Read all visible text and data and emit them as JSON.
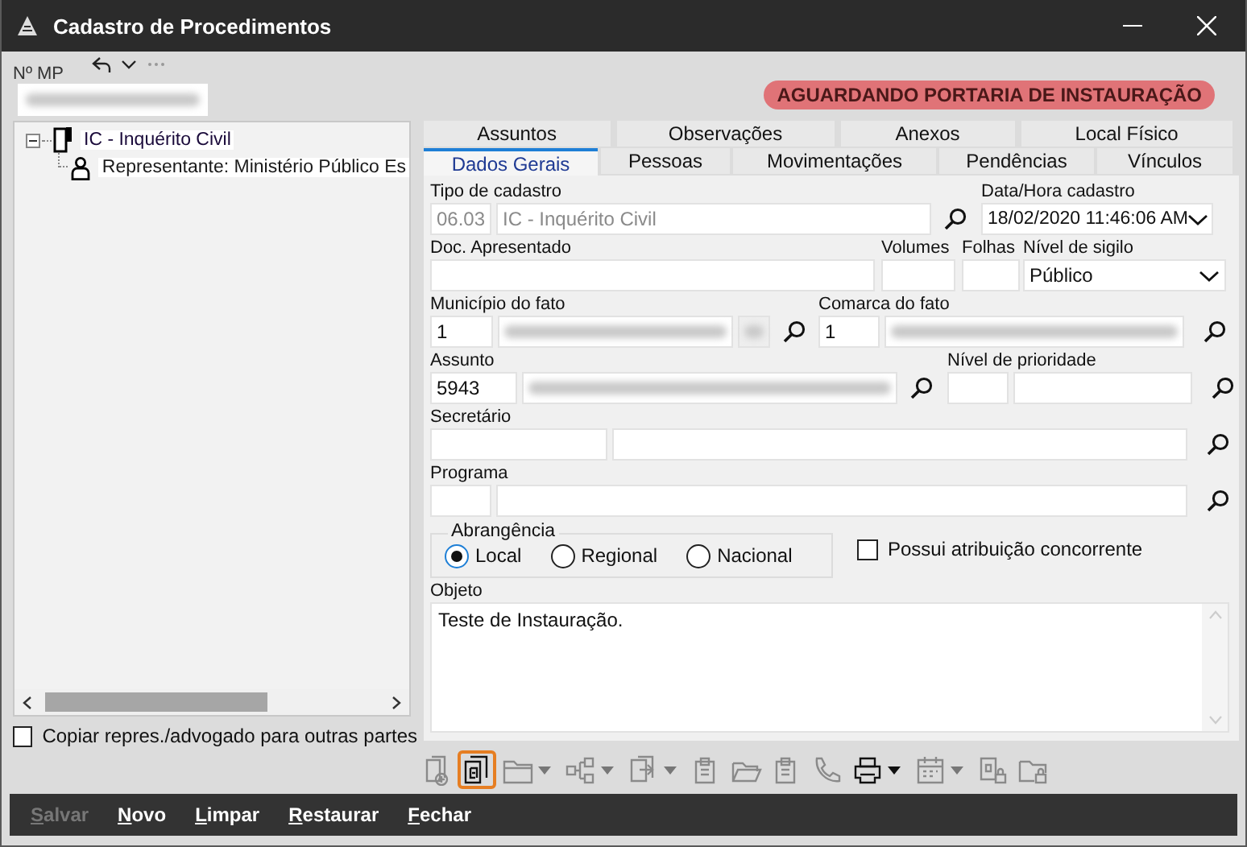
{
  "window": {
    "title": "Cadastro de Procedimentos"
  },
  "mp": {
    "label": "Nº MP",
    "redacted": true
  },
  "status_badge": "AGUARDANDO PORTARIA DE INSTAURAÇÃO",
  "tree": [
    {
      "label": "IC - Inquérito Civil",
      "expanded": true,
      "children": [
        {
          "label": "Representante: Ministério Público Es"
        }
      ]
    }
  ],
  "copy_checkbox": {
    "label": "Copiar repres./advogado para outras partes",
    "checked": false
  },
  "tab_rows": [
    {
      "tabs": [
        {
          "label": "Assuntos",
          "selected": false
        },
        {
          "label": "Observações",
          "selected": false
        },
        {
          "label": "Anexos",
          "selected": false
        },
        {
          "label": "Local Físico",
          "selected": false
        }
      ]
    },
    {
      "tabs": [
        {
          "label": "Dados Gerais",
          "selected": true
        },
        {
          "label": "Pessoas",
          "selected": false
        },
        {
          "label": "Movimentações",
          "selected": false
        },
        {
          "label": "Pendências",
          "selected": false
        },
        {
          "label": "Vínculos",
          "selected": false
        }
      ]
    }
  ],
  "form": {
    "tipo": {
      "label": "Tipo de cadastro",
      "code": "06.03",
      "value": "IC - Inquérito Civil",
      "disabled": true
    },
    "data_hora": {
      "label": "Data/Hora cadastro",
      "value": "18/02/2020 11:46:06 AM"
    },
    "doc": {
      "label": "Doc. Apresentado"
    },
    "volumes": {
      "label": "Volumes"
    },
    "folhas": {
      "label": "Folhas"
    },
    "sigilo": {
      "label": "Nível de sigilo",
      "value": "Público"
    },
    "municipio": {
      "label": "Município do fato",
      "code": "1",
      "redacted": true
    },
    "comarca": {
      "label": "Comarca do fato",
      "code": "1",
      "redacted": true
    },
    "assunto": {
      "label": "Assunto",
      "code": "5943",
      "redacted": true
    },
    "prioridade": {
      "label": "Nível de prioridade"
    },
    "secretario": {
      "label": "Secretário"
    },
    "programa": {
      "label": "Programa"
    },
    "abrangencia": {
      "label": "Abrangência",
      "options": [
        {
          "label": "Local",
          "selected": true
        },
        {
          "label": "Regional",
          "selected": false
        },
        {
          "label": "Nacional",
          "selected": false
        }
      ]
    },
    "concorrente": {
      "label": "Possui atribuição concorrente",
      "checked": false
    },
    "objeto": {
      "label": "Objeto",
      "value": "Teste de Instauração."
    }
  },
  "toolbar": [
    {
      "kind": "docadd",
      "disabled": true,
      "dropdown": false,
      "selected": false
    },
    {
      "kind": "docs",
      "disabled": false,
      "dropdown": false,
      "selected": true
    },
    {
      "kind": "folder",
      "disabled": true,
      "dropdown": true,
      "selected": false
    },
    {
      "kind": "hierarchy",
      "disabled": true,
      "dropdown": true,
      "selected": false
    },
    {
      "kind": "transfer",
      "disabled": true,
      "dropdown": true,
      "selected": false
    },
    {
      "kind": "clipboard",
      "disabled": true,
      "dropdown": false,
      "selected": false
    },
    {
      "kind": "folderopen",
      "disabled": true,
      "dropdown": false,
      "selected": false
    },
    {
      "kind": "clipboard",
      "disabled": true,
      "dropdown": false,
      "selected": false
    },
    {
      "kind": "phone",
      "disabled": true,
      "dropdown": false,
      "selected": false
    },
    {
      "kind": "printer",
      "disabled": false,
      "dropdown": true,
      "selected": false
    },
    {
      "kind": "calendar",
      "disabled": true,
      "dropdown": true,
      "selected": false
    },
    {
      "kind": "doclock",
      "disabled": true,
      "dropdown": false,
      "selected": false
    },
    {
      "kind": "folderlock",
      "disabled": true,
      "dropdown": false,
      "selected": false
    }
  ],
  "buttons": [
    {
      "label": "Salvar",
      "disabled": true
    },
    {
      "label": "Novo",
      "disabled": false
    },
    {
      "label": "Limpar",
      "disabled": false
    },
    {
      "label": "Restaurar",
      "disabled": false
    },
    {
      "label": "Fechar",
      "disabled": false
    }
  ]
}
